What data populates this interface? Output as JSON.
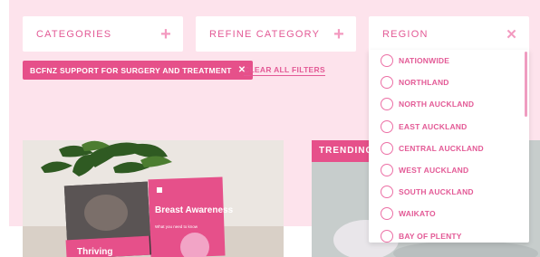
{
  "filters": {
    "categories_label": "CATEGORIES",
    "refine_label": "REFINE CATEGORY",
    "region_label": "REGION",
    "plus_glyph": "+",
    "close_glyph": "✕"
  },
  "active_filter": {
    "label": "BCFNZ SUPPORT FOR SURGERY AND TREATMENT",
    "remove_glyph": "✕"
  },
  "clear_all_label": "CLEAR ALL FILTERS",
  "trending_label": "TRENDING",
  "card1": {
    "booklet_title": "Thriving",
    "booklet2_title": "Breast Awareness",
    "booklet2_sub": "What you need to know"
  },
  "region_options": [
    "NATIONWIDE",
    "NORTHLAND",
    "NORTH AUCKLAND",
    "EAST AUCKLAND",
    "CENTRAL AUCKLAND",
    "WEST AUCKLAND",
    "SOUTH AUCKLAND",
    "WAIKATO",
    "BAY OF PLENTY"
  ],
  "colors": {
    "accent": "#e6508a",
    "background_band": "#fde3ec"
  }
}
